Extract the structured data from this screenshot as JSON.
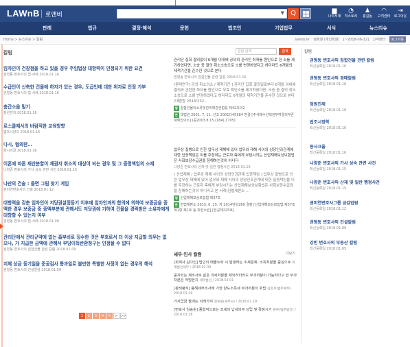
{
  "header": {
    "logo": "LAWnB",
    "logo_sub": "로앤비",
    "search_placeholder": "",
    "search_button": "Q",
    "utils": [
      {
        "icon": "folder-icon",
        "glyph": "▆",
        "label": "나의서재"
      },
      {
        "icon": "history-icon",
        "glyph": "◔",
        "label": "히스토리"
      },
      {
        "icon": "user-icon",
        "glyph": "♟",
        "label": "홍길동"
      },
      {
        "icon": "headset-icon",
        "glyph": "◠",
        "label": "고객센터"
      },
      {
        "icon": "logout-icon",
        "glyph": "⇥",
        "label": "로그아웃"
      }
    ]
  },
  "gnb": [
    "판례",
    "법규",
    "결정·해석",
    "문헌",
    "법조인",
    "기업법무",
    "서식",
    "뉴스리슈"
  ],
  "breadcrumb": "Home > 뉴스이슈 > 칼럼",
  "toolbar": {
    "items": [
      "lawnb.kr",
      "정회원 (개인회원)",
      "[~2018-06-22]",
      "고객센터"
    ],
    "download": "로그아웃"
  },
  "left": {
    "title": "칼럼",
    "items": [
      {
        "title": "임차인이 건장점을 하고 있을 경우 주임법상 대항력이 인정되기 위한 요건",
        "meta": "권형동 변호사의 법·사례 2018.01.16"
      },
      {
        "title": "수급인이 신축한 건물에 하자가 있는 경우, 도급인에 대한 위자료 인정 가부",
        "meta": "권형동 변호사의 법·사례 2018.01.16"
      },
      {
        "title": "층간소음 밀기",
        "meta": "정원진의 2018.01.16"
      },
      {
        "title": "로스쿨제서의 바람직한 교육방향",
        "meta": "법조시장의 2018.01.16"
      },
      {
        "title": "다시, 협의란…",
        "meta": "화시의글 2018.01.16"
      },
      {
        "title": "이혼에 따른 재산분할이 채권자 취소의 대상이 되는 경우 및 그 증명책임의 소재",
        "meta": "나양준 변호사의 가사 상속 관련 사건 2018.01.15"
      },
      {
        "title": "나만의 건술 : 들면 그림 찾기 게임",
        "meta": "권미연변호사의 건술 2018.01.12"
      },
      {
        "title": "대항력을 갖춘 임차인이 저당권설정등기 이후에 임차인과의 합의에 의하여 보증금을 증액한 경우 보증금 중 증액부분에 관해서도 저당권에 기하여 건물을 경락받은 소유자에게 대항할 수 있는지 여부",
        "meta": "권형동 변호사의 법·사례 2018.01.09"
      },
      {
        "title": "관리단에서 관리규약에 없는 흡부비로 징수한 것은 부호로서 더 이상 지급할 의무는 없으나, 가 지급한 금액에 관해서 부당이득반환청구는 인정될 수 없다",
        "meta": "권형동 변호사의 집합건물 관련 칼럼 2018.01.09"
      },
      {
        "title": "지체 상금 등기일을 준공검사 통과일로 볼만한 특별한 사정이 없는 경우의 해석",
        "meta": "권형동 변호사의 건설칼럼 2018.01.09"
      }
    ],
    "pages": [
      "1",
      "2",
      "3",
      "4",
      "5",
      ">",
      ">>"
    ]
  },
  "middle": {
    "search_placeholder": "칼럼 검색",
    "search_button": "검색",
    "block1": {
      "para": "관리단 집회 결의없이 6개월 이내에 공의의 관리인 취재를 원인으로 한 소를 제기하였다면, 소송 중 결의 취소소송으로 소를 변경하였다고 하더라도 6개월의 제척기간을 준수한 것으로 본다",
      "meta": "권형동 변호사의 집합건물 관련 칼럼 2018.01.16",
      "para2": "[판례연구] 공의 취소의소 / 제척기간 ] 관리단 집회 결의일로부터 6개월 이내에 결의와 관련한 하자를 원인으로 무효 확인소를 제기하였다면, 소송 중 결의 취소소송으로 소를 변경하였다고 하더라도 6개월의 제척기간을 준수한 것으로 본다(대법원 2016다32...",
      "ref1": "집합건물의소유및관리에관한법률 제42조의2",
      "ref2": "대법원 2001. 7. 11. 선고 2001다45584 판결 [주식매수선택권부여결의부존재확인의소] (공2003.8.15.(184),1705)"
    },
    "block2": {
      "para": "업무상 질병으로 인한 업무상 재해에 있어 업무와 재해 사이의 상당인과관계에 대한 입증책임은 이를 주장하는 근로자 측에게 부담시키는 산업재해보상보험법은 사회보장수급권을 침해하는것이 아니다",
      "meta": "나양준 변호사의 산재 및 일반 행정사건 2018.01.15",
      "para2": "[ 산업재해 / 업무와 재해 사이의 상당인과관계 입증책임 ] 업무상 질병으로 인한 업무상 재해에 있어 업무와 재해 사이의 상당인과관계에 대한 입증책임을 이를 주장하는 근로자 측에게 부담시키는 산업재해보상보험법은 사회보장수급권을 침해하는것이 아니라고 본 사례(헌법재판소 ...",
      "ref1": "산업재해보상보험법 제37조",
      "ref2": "헌법재판소 2015. 6. 25. 자 2014헌바269 결정 [산업재해보상보험법 제37조 제1항 제1호 등 위헌소원] [헌공제225호]"
    }
  },
  "column": {
    "title": "세무·인사 칼럼",
    "more": "더보기",
    "items": [
      {
        "title": "[회계사 김다인] 법인의 매출누락 시 발생하는 조세문제- 소득처분을 중심으로",
        "meta": "회계법인세무 / 2018.02.09"
      },
      {
        "title": "공지되는 제조사로 같은 과세처분을 제외하더라도 부과처분이 가능하다고 한 부과처분은 적법한지",
        "meta": "세무법인 / 2018.02.01"
      },
      {
        "title": "[판례평석] 용해세부조사에 기한 양도소득세 부과처분의 위법",
        "meta": "김한서(법무세무) 2018.01.29"
      },
      {
        "title": "가지급금 할애는 이래가지",
        "meta": "정보원(세무사) / 2018.01.29"
      },
      {
        "title": "[변호사 임승순] 종합적으로는 조세의 납세의무 성립 및 확정시기",
        "meta": "화우(법무법인) / 2018.01.26"
      }
    ]
  },
  "right": {
    "title": "칼럼",
    "items": [
      {
        "title": "권형동 변호사의 집합건물 관련 칼럼",
        "meta": "최신등록일 2018.01.16"
      },
      {
        "title": "권형동 변호사의 경매칼럼",
        "meta": "최신등록일 2018.01.16"
      },
      {
        "title": "정원진제",
        "meta": "최신등록일 2018.01.16"
      },
      {
        "title": "법조시장학",
        "meta": "최신등록일 2018.01.16"
      },
      {
        "title": "동사크울",
        "meta": "최신등록일 2018.01.16"
      },
      {
        "title": "나양준 변호사의 가사 상속 관련 사건",
        "meta": "최신등록일 2018.01.15"
      },
      {
        "title": "나양준 변호사의 산재 및 일반 행정사건",
        "meta": "최신등록일 2018.01.15"
      },
      {
        "title": "권미연변호사그룹 금감법원",
        "meta": "최신등록일 2018.01.12"
      },
      {
        "title": "권형동 변호사의 건설칼럼",
        "meta": "최신등록일 2018.01.09"
      },
      {
        "title": "강빈 변호사의 부동산 칼럼",
        "meta": "최신등록일 2018.01.05"
      }
    ]
  },
  "colors": {
    "brand": "#2a4a84",
    "gnb": "#213d72",
    "accent": "#e8542a",
    "link": "#2a4f8e"
  }
}
